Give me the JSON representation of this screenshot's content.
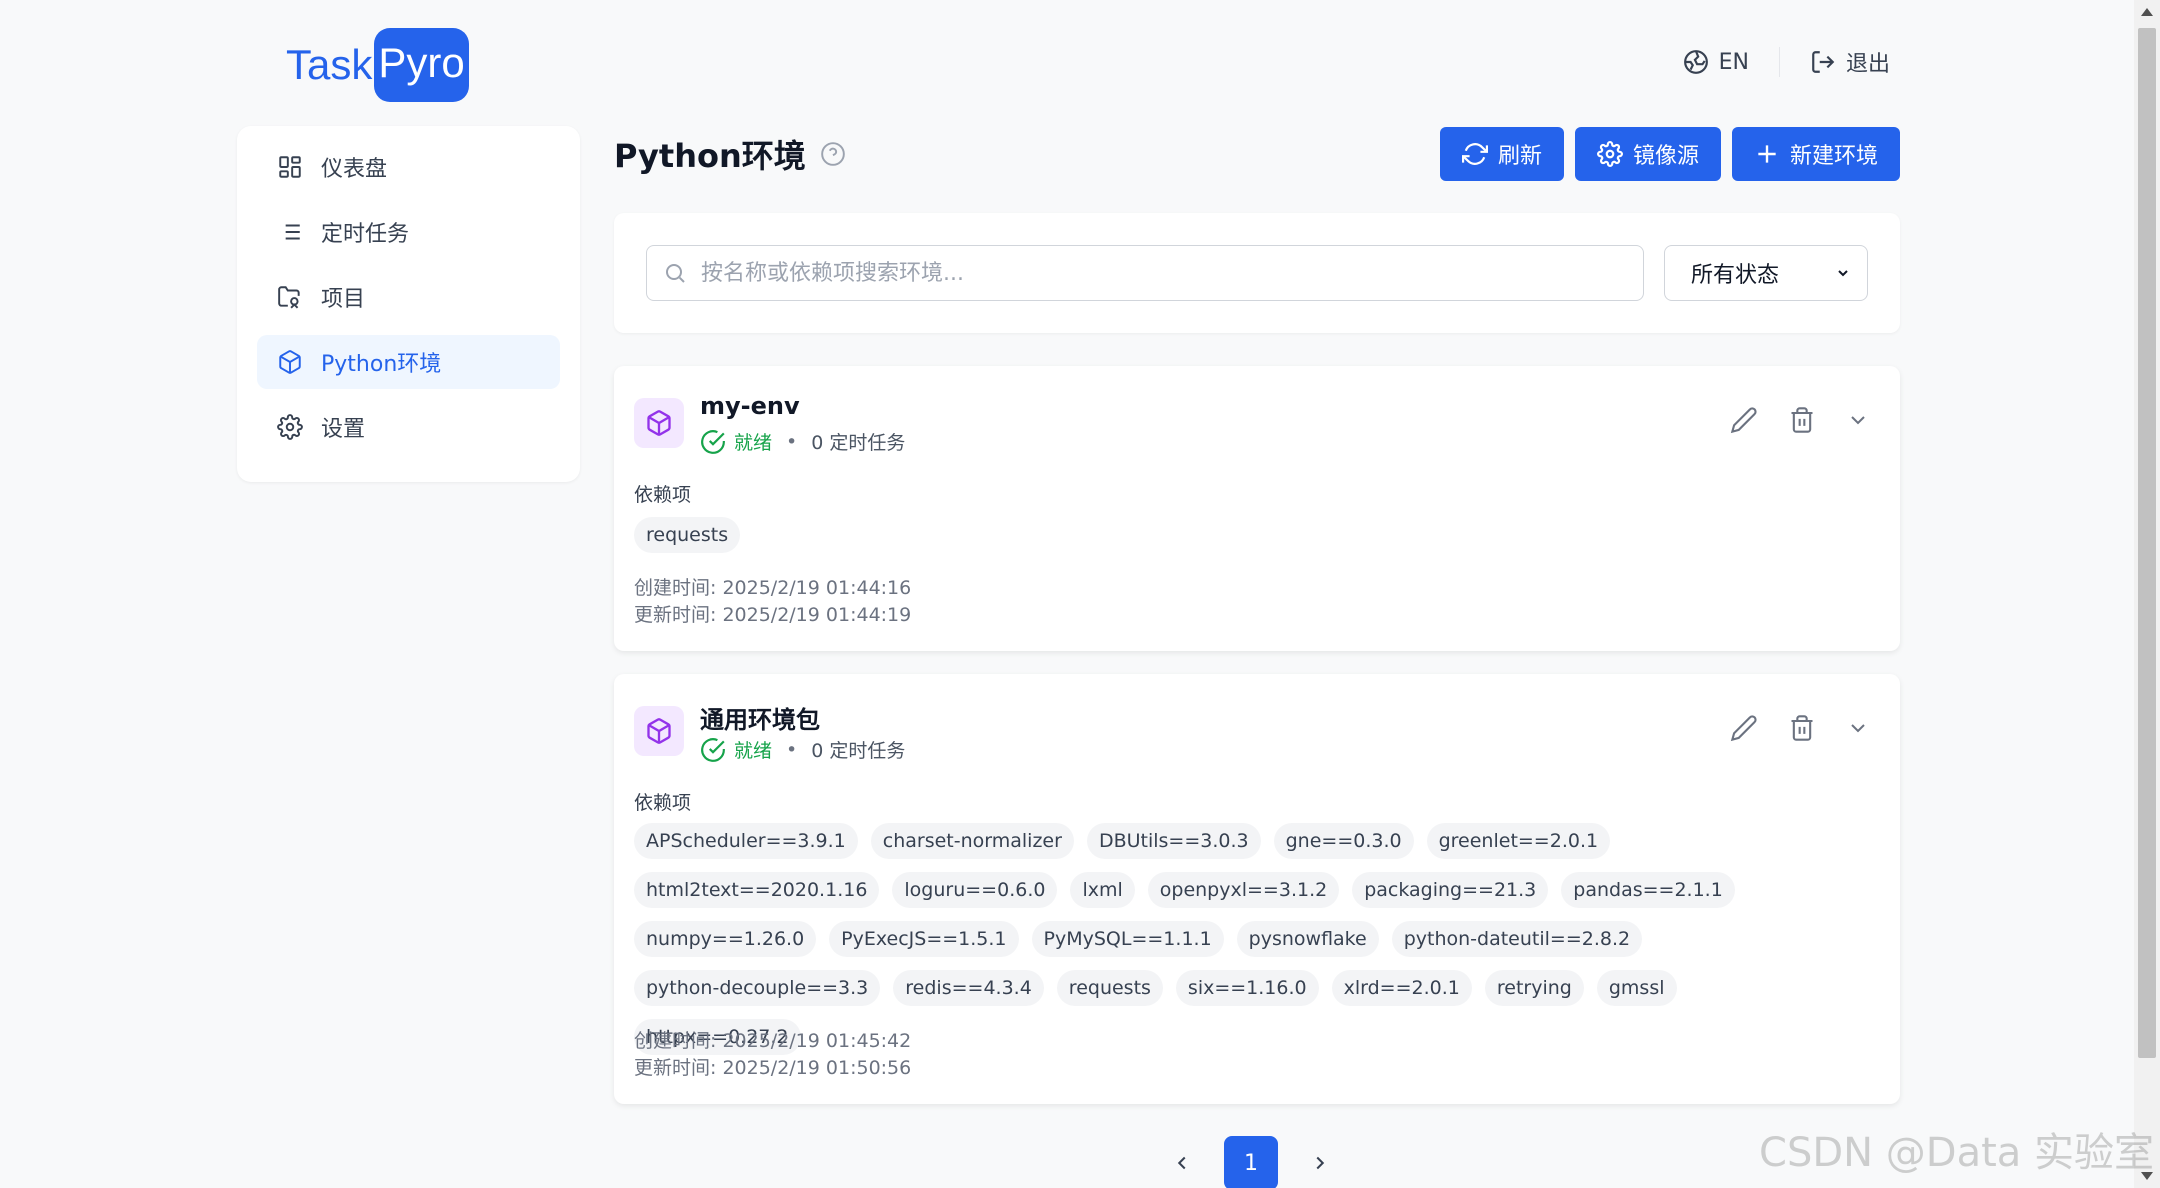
{
  "logo": {
    "part1": "Task",
    "part2": "Pyro"
  },
  "topbar": {
    "language": "EN",
    "logout": "退出"
  },
  "sidebar": {
    "items": [
      {
        "label": "仪表盘",
        "icon": "dashboard-icon"
      },
      {
        "label": "定时任务",
        "icon": "list-icon"
      },
      {
        "label": "项目",
        "icon": "project-folder-icon"
      },
      {
        "label": "Python环境",
        "icon": "cube-icon",
        "active": true
      },
      {
        "label": "设置",
        "icon": "gear-icon"
      }
    ]
  },
  "page": {
    "title": "Python环境",
    "actions": {
      "refresh": "刷新",
      "mirror": "镜像源",
      "new_env": "新建环境"
    }
  },
  "filters": {
    "search_placeholder": "按名称或依赖项搜索环境...",
    "status_selected": "所有状态"
  },
  "envs": [
    {
      "name": "my-env",
      "status": "就绪",
      "tasks": "0 定时任务",
      "deps_label": "依赖项",
      "deps": [
        "requests"
      ],
      "created": "创建时间: 2025/2/19 01:44:16",
      "updated": "更新时间: 2025/2/19 01:44:19"
    },
    {
      "name": "通用环境包",
      "status": "就绪",
      "tasks": "0 定时任务",
      "deps_label": "依赖项",
      "deps": [
        "APScheduler==3.9.1",
        "charset-normalizer",
        "DBUtils==3.0.3",
        "gne==0.3.0",
        "greenlet==2.0.1",
        "html2text==2020.1.16",
        "loguru==0.6.0",
        "lxml",
        "openpyxl==3.1.2",
        "packaging==21.3",
        "pandas==2.1.1",
        "numpy==1.26.0",
        "PyExecJS==1.5.1",
        "PyMySQL==1.1.1",
        "pysnowflake",
        "python-dateutil==2.8.2",
        "python-decouple==3.3",
        "redis==4.3.4",
        "requests",
        "six==1.16.0",
        "xlrd==2.0.1",
        "retrying",
        "gmssl",
        "httpx==0.27.2"
      ],
      "created": "创建时间: 2025/2/19 01:45:42",
      "updated": "更新时间: 2025/2/19 01:50:56"
    }
  ],
  "pagination": {
    "current": "1"
  },
  "watermark": "CSDN @Data 实验室",
  "colors": {
    "primary": "#2563eb",
    "ready": "#16a34a",
    "env_icon_bg": "#f3e8ff",
    "env_icon": "#9333ea"
  }
}
